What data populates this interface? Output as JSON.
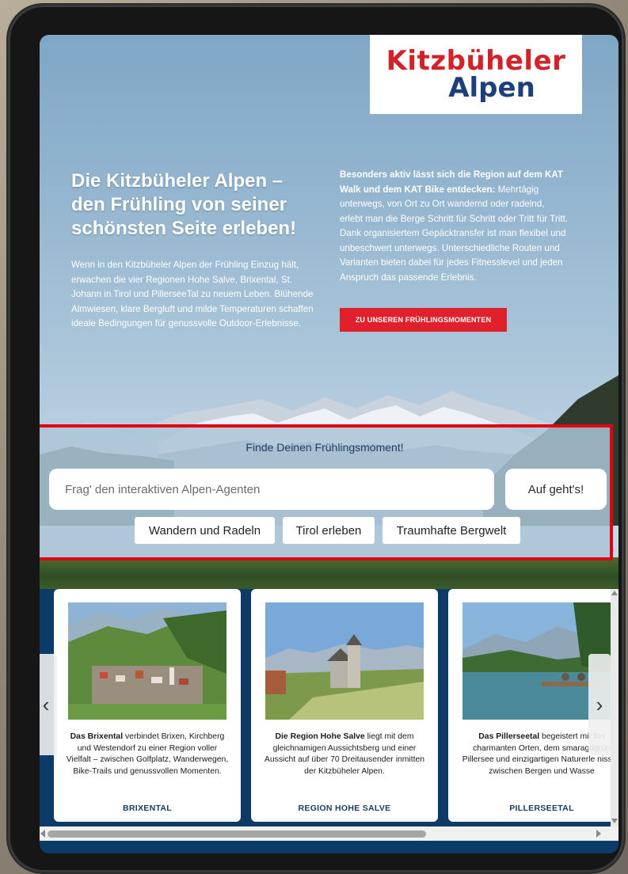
{
  "logo": {
    "line1": "Kitzbüheler",
    "line2": "Alpen"
  },
  "hero": {
    "headline": "Die Kitzbüheler Alpen – den Frühling von seiner schönsten Seite erleben!",
    "intro": "Wenn in den Kitzbüheler Alpen der Frühling Einzug hält, erwachen die vier Regionen Hohe Salve, Brixental, St. Johann in Tirol und PillerseeTal zu neuem Leben. Blühende Almwiesen, klare Bergluft und milde Temperaturen schaffen ideale Bedingungen für genussvolle Outdoor-Erlebnisse.",
    "side_bold": "Besonders aktiv lässt sich die Region auf dem KAT Walk und dem KAT Bike entdecken:",
    "side_text": " Mehrtägig unterwegs, von Ort zu Ort wandernd oder radelnd, erlebt man die Berge Schritt für Schritt oder Tritt für Tritt. Dank organisiertem Gepäcktransfer ist man flexibel und unbeschwert unterwegs. Unterschiedliche Routen und Varianten bieten dabei für jedes Fitnesslevel und jeden Anspruch das passende Erlebnis.",
    "cta_label": "ZU UNSEREN FRÜHLINGSMOMENTEN"
  },
  "agent": {
    "title": "Finde Deinen Frühlingsmoment!",
    "input_placeholder": "Frag' den interaktiven Alpen-Agenten",
    "submit_label": "Auf geht's!",
    "chips": [
      "Wandern und Radeln",
      "Tirol erleben",
      "Traumhafte Bergwelt"
    ]
  },
  "cards": [
    {
      "bold": "Das Brixental",
      "text": " verbindet Brixen, Kirchberg und Westendorf zu einer Region voller Vielfalt – zwischen Golfplatz, Wanderwegen, Bike-Trails und genussvollen Momenten.",
      "category": "BRIXENTAL"
    },
    {
      "bold": "Die Region Hohe Salve",
      "text": " liegt mit dem gleichnamigen Aussichtsberg und einer Aussicht auf über 70 Dreitausender inmitten der Kitzbüheler Alpen.",
      "category": "REGION HOHE SALVE"
    },
    {
      "bold": "Das Pillerseetal",
      "text": " begeistert mit fün charmanten Orten, dem smaragdgrün Pillersee und einzigartigen Naturerle nissen zwischen Bergen und Wasse",
      "category": "PILLERSEETAL"
    }
  ],
  "icons": {
    "prev": "chevron-left-icon",
    "next": "chevron-right-icon"
  },
  "colors": {
    "accent_red": "#e0202a",
    "brand_blue": "#1f3f7a",
    "cards_bg": "#0d3b68"
  }
}
